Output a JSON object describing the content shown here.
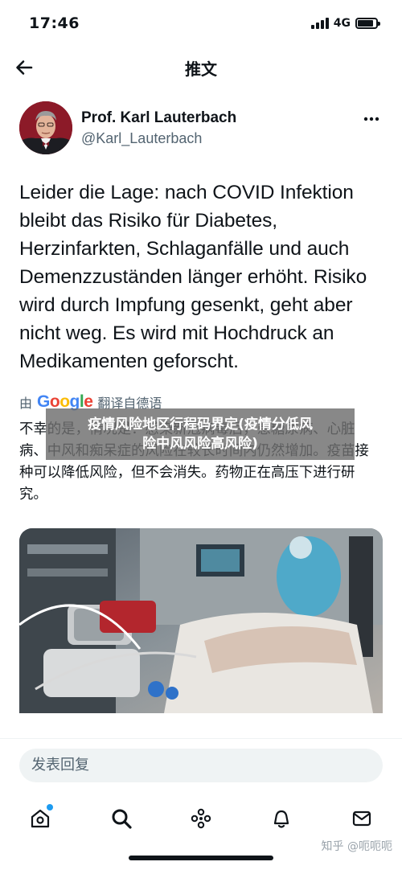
{
  "status_bar": {
    "time": "17:46",
    "network": "4G",
    "battery_level": 0.85
  },
  "header": {
    "title": "推文"
  },
  "tweet": {
    "author_name": "Prof. Karl Lauterbach",
    "author_handle": "@Karl_Lauterbach",
    "text": "Leider die Lage: nach COVID Infektion bleibt das Risiko für Diabetes, Herzinfarkten, Schlaganfälle und auch Demenzzuständen länger erhöht. Risiko wird durch Impfung gesenkt, geht aber nicht weg. Es wird mit Hochdruck an Medikamenten geforscht.",
    "translate_prefix": "由",
    "translate_suffix": "翻译自德语",
    "translated_text": "不幸的是，情况是：感染新冠病毒后，患糖尿病、心脏病、中风和痴呆症的风险在较长时间内仍然增加。疫苗接种可以降低风险，但不会消失。药物正在高压下进行研究。"
  },
  "overlay_banner": {
    "line1": "疫情风险地区行程码界定(疫情分低风",
    "line2": "险中风风险高风险)"
  },
  "reply": {
    "placeholder": "发表回复"
  },
  "bottom_nav": {
    "items": [
      {
        "icon": "home-icon",
        "has_notification_dot": true
      },
      {
        "icon": "search-icon"
      },
      {
        "icon": "spaces-icon"
      },
      {
        "icon": "notifications-icon"
      },
      {
        "icon": "messages-icon"
      }
    ],
    "accent_color": "#1d9bf0"
  },
  "watermark": "知乎 @呃呃呃"
}
